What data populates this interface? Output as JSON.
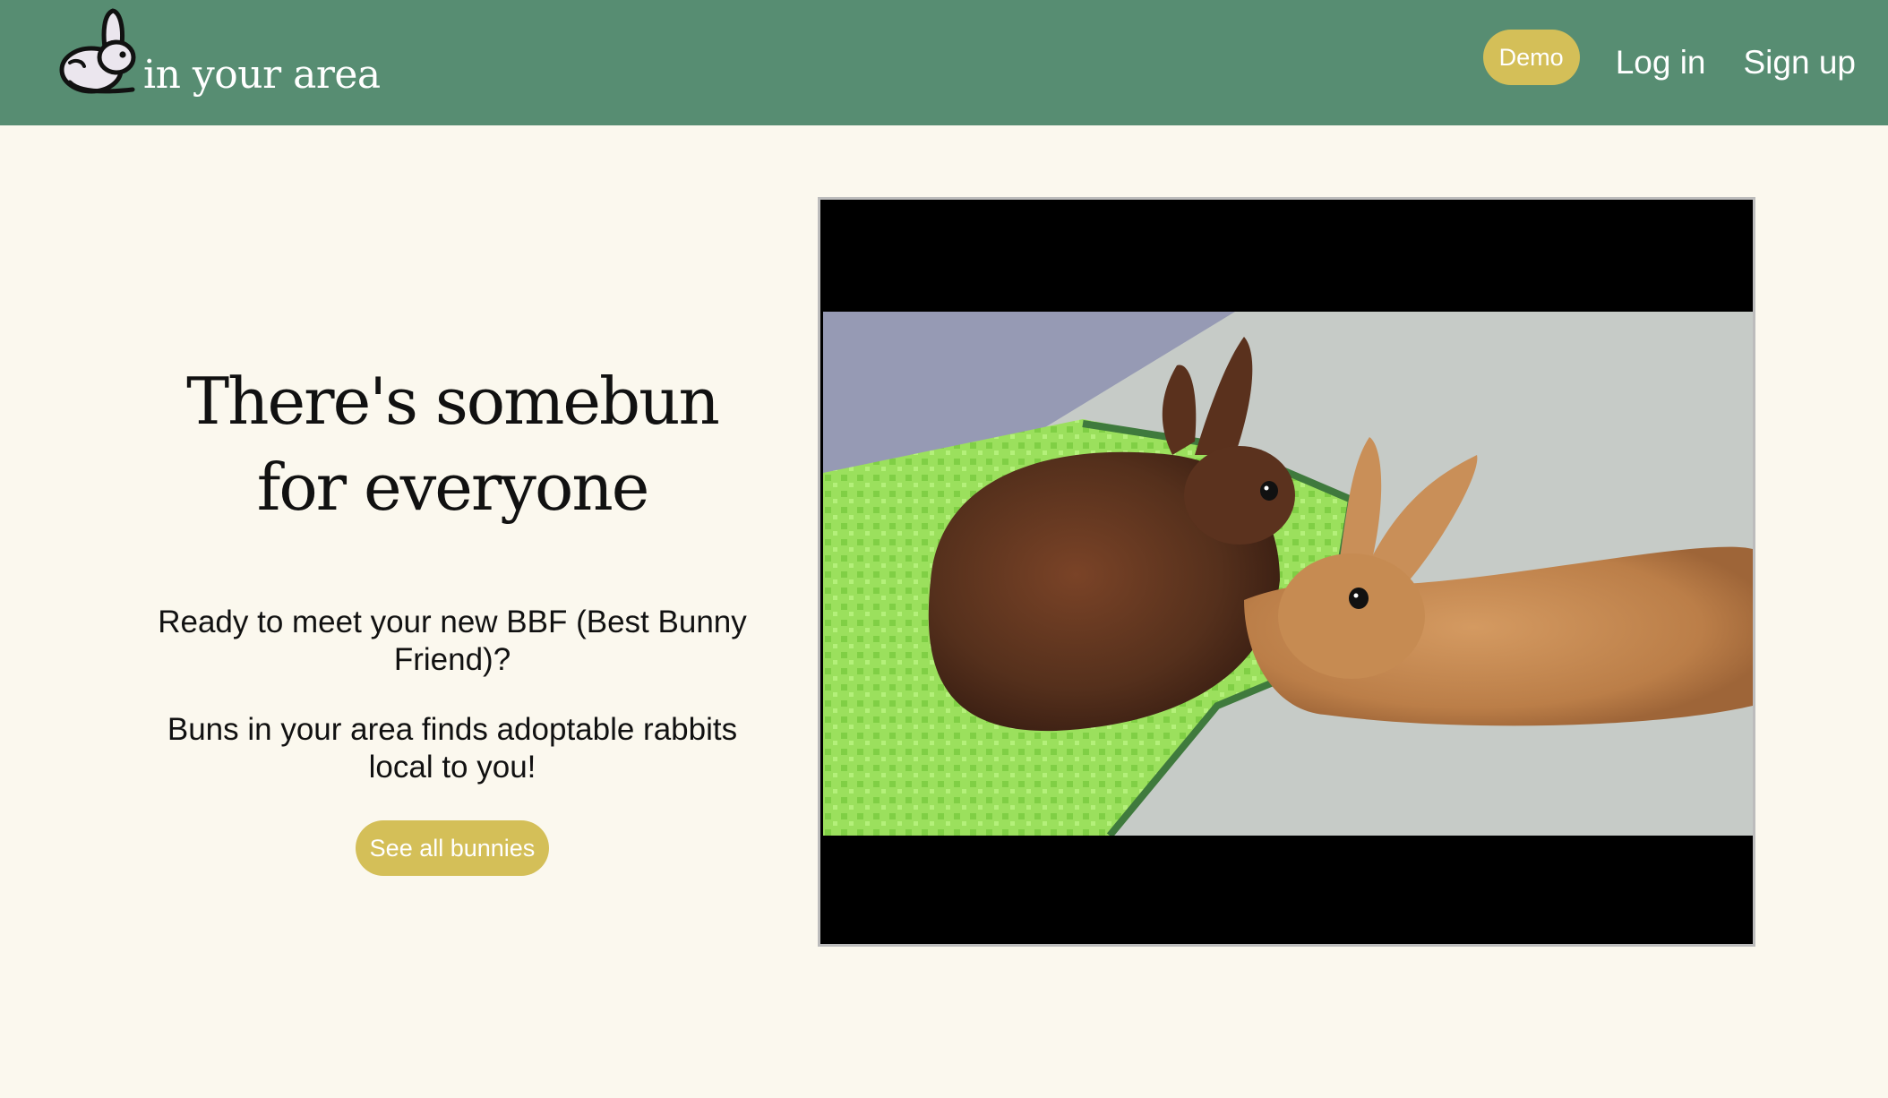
{
  "navbar": {
    "brand_text": "in your area",
    "logo_icon": "rabbit-icon",
    "demo_label": "Demo",
    "login_label": "Log in",
    "signup_label": "Sign up",
    "background_color": "#578d72",
    "accent_color": "#d4bf58"
  },
  "hero": {
    "title": "There's somebun for everyone",
    "text_1": "Ready to meet your new BBF (Best Bunny Friend)?",
    "text_2": "Buns in your area finds adoptable rabbits local to you!",
    "cta_label": "See all bunnies"
  },
  "media": {
    "subject": "two rabbits, one brown and one orange, resting on a green foam mat"
  }
}
